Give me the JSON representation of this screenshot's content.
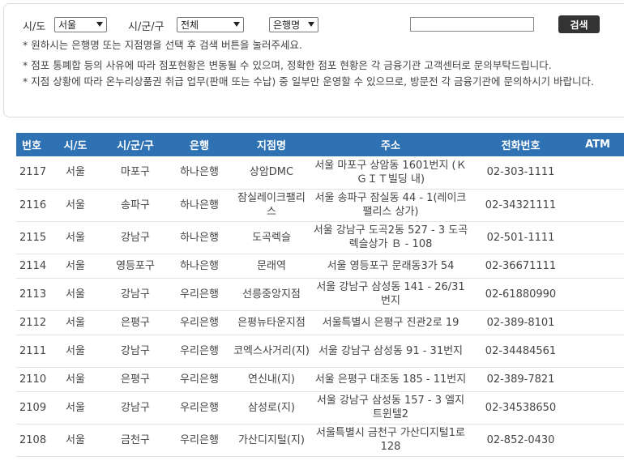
{
  "search": {
    "sido_label": "시/도",
    "sido_value": "서울",
    "sigungu_label": "시/군/구",
    "sigungu_value": "전체",
    "type_value": "은행명",
    "button_label": "검색"
  },
  "notes": [
    "* 원하시는 은행명 또는 지점명을 선택 후 검색 버튼을 눌러주세요.",
    "* 점포 통폐합 등의 사유에 따라 점포현황은 변동될 수 있으며, 정확한 점포 현황은 각 금융기관 고객센터로 문의부탁드립니다.",
    "* 지점 상황에 따라 온누리상품권 취급 업무(판매 또는 수납) 중 일부만 운영할 수 있으므로, 방문전 각 금융기관에 문의하시기 바랍니다."
  ],
  "table": {
    "headers": [
      "번호",
      "시/도",
      "시/군/구",
      "은행",
      "지점명",
      "주소",
      "전화번호",
      "ATM"
    ],
    "rows": [
      [
        "2117",
        "서울",
        "마포구",
        "하나은행",
        "상암DMC",
        "서울 마포구 상암동 1601번지 (ＫＧＩＴ빌딩 내)",
        "02-303-1111",
        ""
      ],
      [
        "2116",
        "서울",
        "송파구",
        "하나은행",
        "잠실레이크팰리스",
        "서울 송파구 잠실동 44 - 1(레이크팰리스 상가)",
        "02-34321111",
        ""
      ],
      [
        "2115",
        "서울",
        "강남구",
        "하나은행",
        "도곡렉슬",
        "서울 강남구 도곡2동 527 - 3 도곡렉슬상가 Ｂ - 108",
        "02-501-1111",
        ""
      ],
      [
        "2114",
        "서울",
        "영등포구",
        "하나은행",
        "문래역",
        "서울 영등포구 문래동3가 54",
        "02-36671111",
        ""
      ],
      [
        "2113",
        "서울",
        "강남구",
        "우리은행",
        "선릉중앙지점",
        "서울 강남구 삼성동 141 - 26/31번지",
        "02-61880990",
        ""
      ],
      [
        "2112",
        "서울",
        "은평구",
        "우리은행",
        "은평뉴타운지점",
        "서울특별시 은평구 진관2로 19",
        "02-389-8101",
        ""
      ],
      [
        "2111",
        "서울",
        "강남구",
        "우리은행",
        "코엑스사거리(지)",
        "서울 강남구 삼성동 91 - 31번지",
        "02-34484561",
        ""
      ],
      [
        "2110",
        "서울",
        "은평구",
        "우리은행",
        "연신내(지)",
        "서울 은평구 대조동 185 - 11번지",
        "02-389-7821",
        ""
      ],
      [
        "2109",
        "서울",
        "강남구",
        "우리은행",
        "삼성로(지)",
        "서울 강남구 삼성동 157 - 3 엘지트윈텔2",
        "02-34538650",
        ""
      ],
      [
        "2108",
        "서울",
        "금천구",
        "우리은행",
        "가산디지털(지)",
        "서울특별시 금천구 가산디지털1로 128",
        "02-852-0430",
        ""
      ]
    ]
  }
}
